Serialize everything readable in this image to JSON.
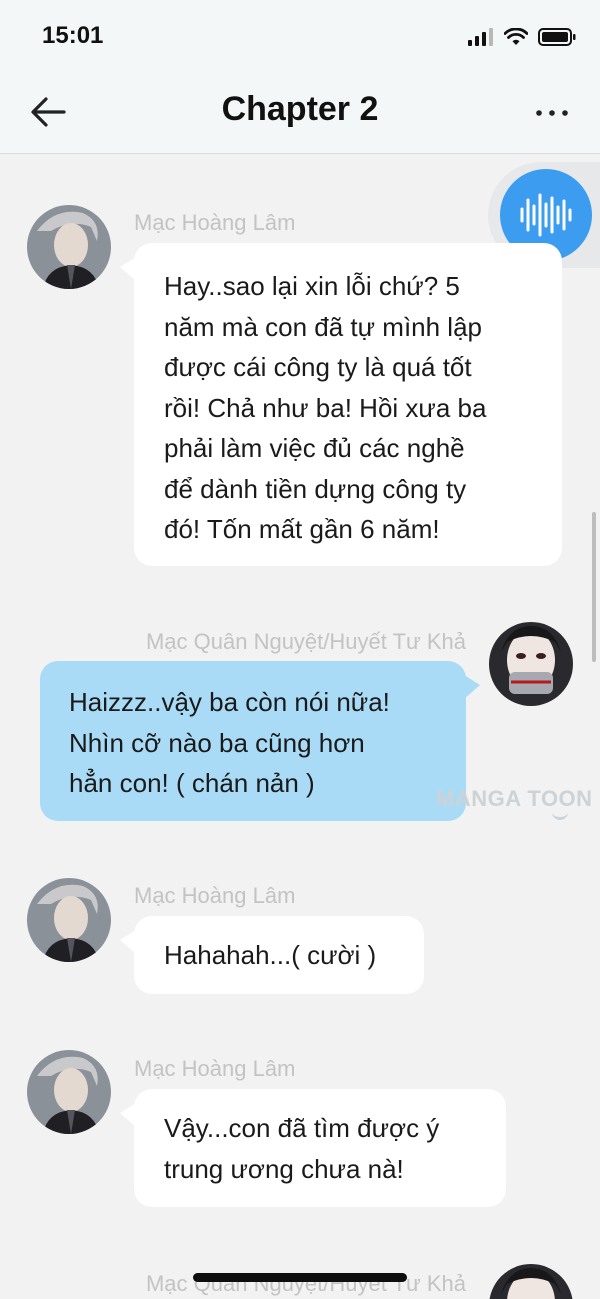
{
  "status_bar": {
    "time": "15:01"
  },
  "header": {
    "title": "Chapter 2"
  },
  "watermark": "MANGA TOON",
  "messages": [
    {
      "sender": "Mạc Hoàng Lâm",
      "side": "left",
      "lines": [
        "Hay..sao lại xin lỗi chứ? 5",
        "năm mà con đã tự mình lập",
        "được cái công ty là quá tốt",
        "rồi! Chả như ba! Hồi xưa ba",
        "phải làm việc đủ các nghề",
        "để dành tiền dựng công ty",
        "đó! Tốn mất gần 6 năm!"
      ]
    },
    {
      "sender": "Mạc Quân Nguyệt/Huyết Tư Khả",
      "side": "right",
      "lines": [
        "Haizzz..vậy ba còn nói nữa!",
        "Nhìn cỡ nào ba cũng hơn",
        "hẳn con! ( chán nản )"
      ]
    },
    {
      "sender": "Mạc Hoàng Lâm",
      "side": "left",
      "lines": [
        "Hahahah...( cười )"
      ]
    },
    {
      "sender": "Mạc Hoàng Lâm",
      "side": "left",
      "lines": [
        "Vậy...con đã tìm được ý",
        "trung ương chưa nà!"
      ]
    },
    {
      "sender": "Mạc Quân Nguyệt/Huyết Tư Khả",
      "side": "right",
      "lines": []
    }
  ],
  "colors": {
    "right_bubble": "#a9dbf7",
    "left_bubble": "#ffffff",
    "audio_button": "#3b9cf0",
    "background": "#f2f2f2"
  },
  "icons": {
    "back": "arrow-left-icon",
    "more": "more-horizontal-icon",
    "audio": "audio-waveform-icon"
  }
}
